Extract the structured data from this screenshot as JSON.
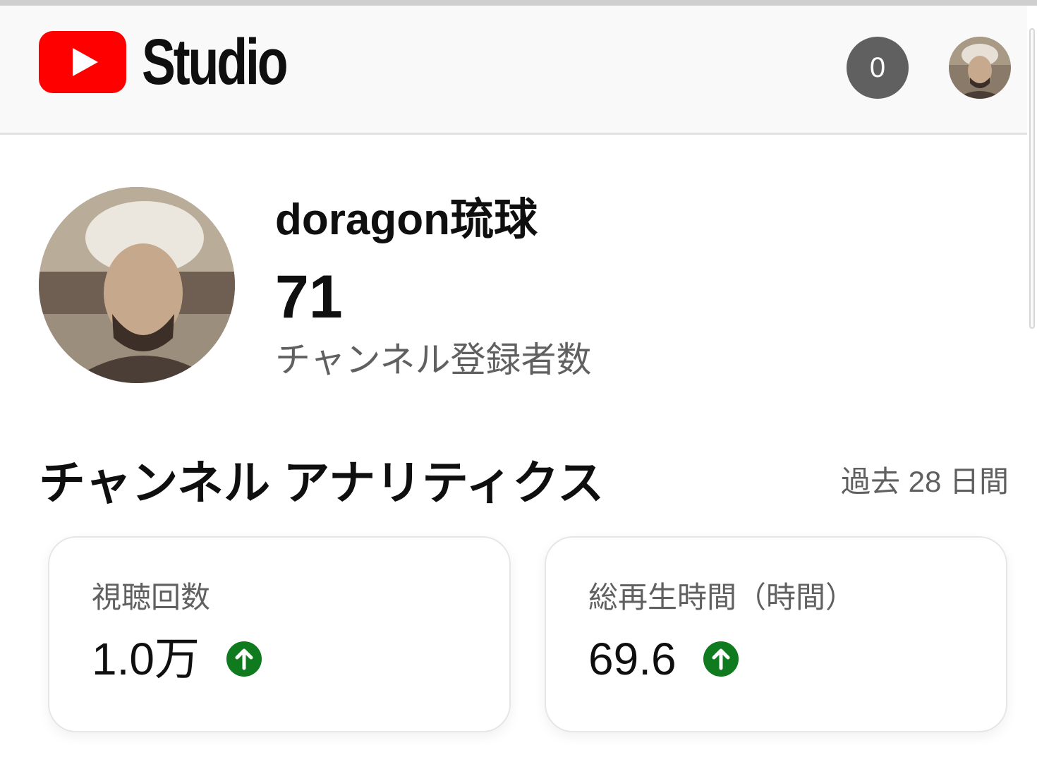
{
  "header": {
    "logo_text": "Studio",
    "notification_count": "0",
    "brand_red": "#ff0000"
  },
  "channel": {
    "name": "doragon琉球",
    "subscriber_count": "71",
    "subscriber_label": "チャンネル登録者数"
  },
  "analytics": {
    "title": "チャンネル アナリティクス",
    "period": "過去 28 日間",
    "cards": [
      {
        "label": "視聴回数",
        "value": "1.0万",
        "trend": "up",
        "trend_icon": "arrow-up-circle-icon",
        "trend_color": "#0f7a1e"
      },
      {
        "label": "総再生時間（時間）",
        "value": "69.6",
        "trend": "up",
        "trend_icon": "arrow-up-circle-icon",
        "trend_color": "#0f7a1e"
      }
    ]
  }
}
